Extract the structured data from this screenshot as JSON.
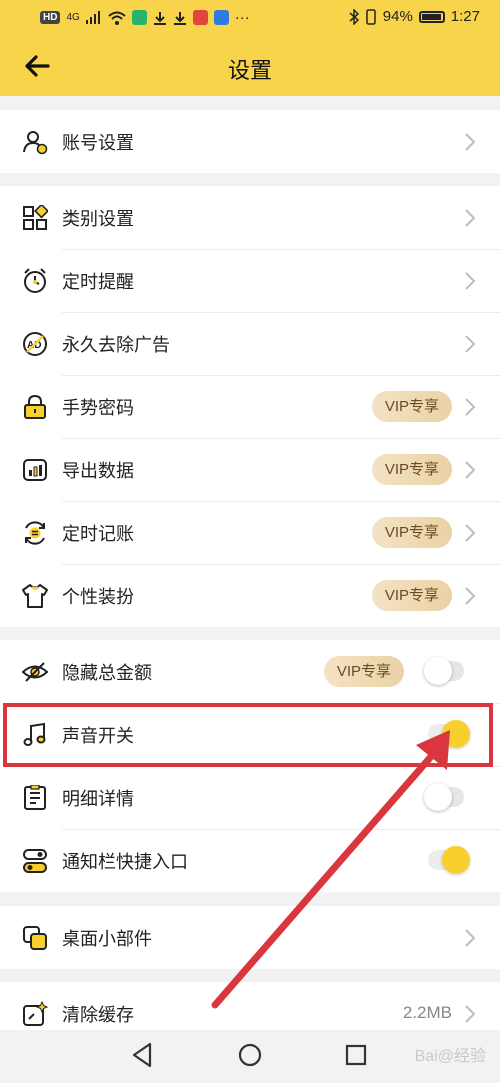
{
  "status_bar": {
    "left_badges": [
      "HD",
      "4G"
    ],
    "more": "···",
    "battery": "94%",
    "time": "1:27"
  },
  "header": {
    "title": "设置"
  },
  "sections": [
    {
      "items": [
        {
          "label": "账号设置",
          "icon": "user-settings-icon",
          "trailing": "chevron"
        }
      ]
    },
    {
      "items": [
        {
          "label": "类别设置",
          "icon": "category-icon",
          "trailing": "chevron"
        },
        {
          "label": "定时提醒",
          "icon": "alarm-clock-icon",
          "trailing": "chevron"
        },
        {
          "label": "永久去除广告",
          "icon": "no-ads-icon",
          "trailing": "chevron"
        },
        {
          "label": "手势密码",
          "icon": "lock-icon",
          "badge": "VIP专享",
          "trailing": "chevron"
        },
        {
          "label": "导出数据",
          "icon": "export-data-icon",
          "badge": "VIP专享",
          "trailing": "chevron"
        },
        {
          "label": "定时记账",
          "icon": "scheduled-bookkeeping-icon",
          "badge": "VIP专享",
          "trailing": "chevron"
        },
        {
          "label": "个性装扮",
          "icon": "tshirt-icon",
          "badge": "VIP专享",
          "trailing": "chevron"
        }
      ]
    },
    {
      "items": [
        {
          "label": "隐藏总金额",
          "icon": "eye-hidden-icon",
          "badge": "VIP专享",
          "toggle": false
        },
        {
          "label": "声音开关",
          "icon": "music-note-icon",
          "toggle": true
        },
        {
          "label": "明细详情",
          "icon": "details-list-icon",
          "toggle": false
        },
        {
          "label": "通知栏快捷入口",
          "icon": "notification-toggle-icon",
          "toggle": true
        }
      ]
    },
    {
      "items": [
        {
          "label": "桌面小部件",
          "icon": "widget-icon",
          "trailing": "chevron"
        }
      ]
    },
    {
      "items": [
        {
          "label": "清除缓存",
          "icon": "clear-cache-icon",
          "value": "2.2MB",
          "trailing": "chevron"
        }
      ]
    }
  ],
  "watermark": "Bai@经验",
  "colors": {
    "header": "#f8d44a",
    "toggle_on": "#f7cf2f",
    "annotation": "#d9363e",
    "vip_text": "#6b4b22"
  }
}
